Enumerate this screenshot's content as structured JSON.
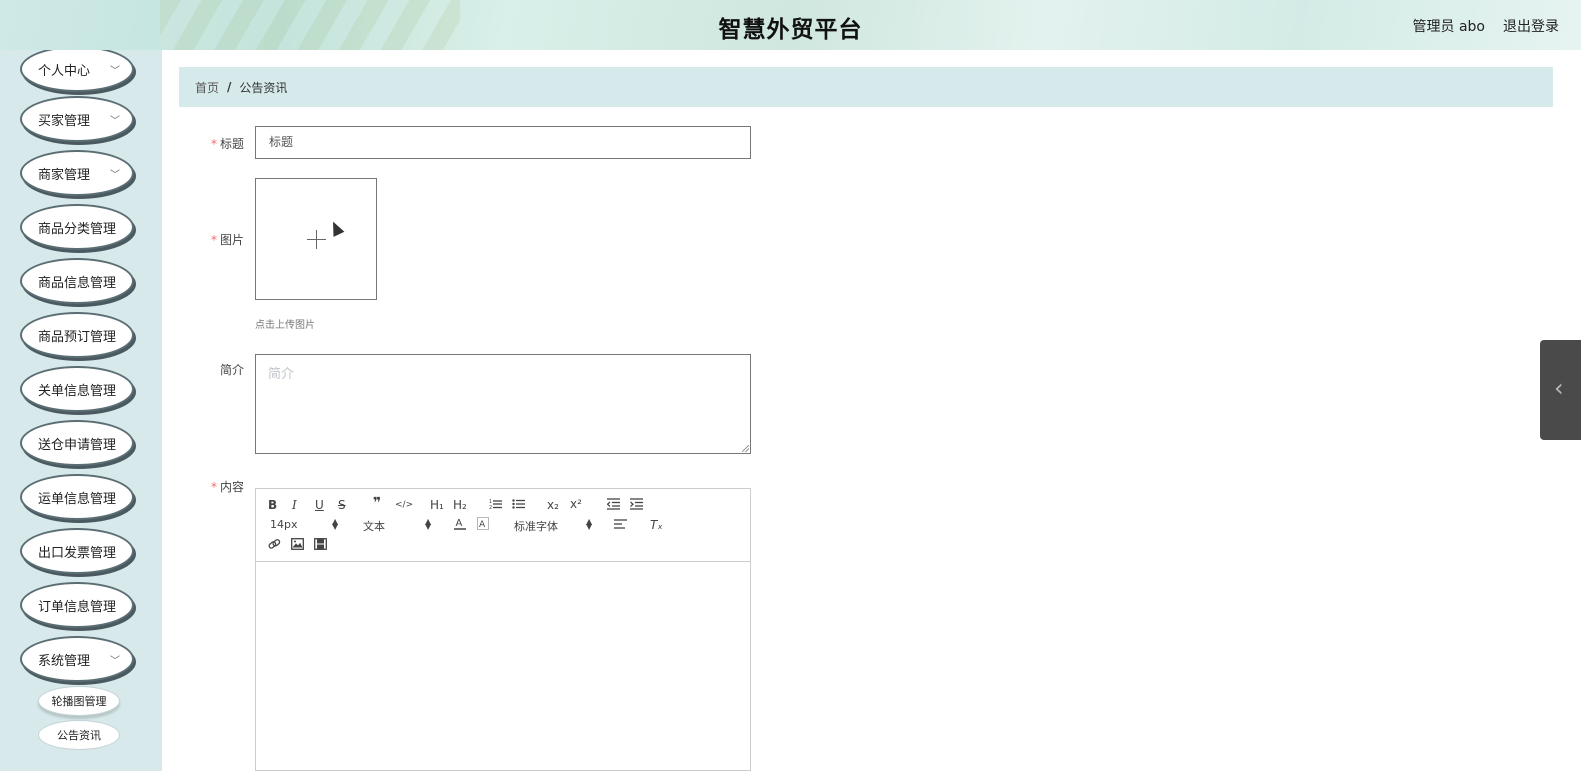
{
  "header": {
    "title": "智慧外贸平台",
    "user": "管理员 abo",
    "logout": "退出登录"
  },
  "sidebar": {
    "items": [
      {
        "label": "个人中心",
        "chevron": true
      },
      {
        "label": "买家管理",
        "chevron": true
      },
      {
        "label": "商家管理",
        "chevron": true
      },
      {
        "label": "商品分类管理",
        "chevron": false
      },
      {
        "label": "商品信息管理",
        "chevron": false
      },
      {
        "label": "商品预订管理",
        "chevron": false
      },
      {
        "label": "关单信息管理",
        "chevron": false
      },
      {
        "label": "送仓申请管理",
        "chevron": false
      },
      {
        "label": "运单信息管理",
        "chevron": false
      },
      {
        "label": "出口发票管理",
        "chevron": false
      },
      {
        "label": "订单信息管理",
        "chevron": false
      },
      {
        "label": "系统管理",
        "chevron": true
      }
    ],
    "sub_items": [
      "轮播图管理",
      "公告资讯"
    ]
  },
  "breadcrumb": {
    "home": "首页",
    "separator": "/",
    "current": "公告资讯"
  },
  "form": {
    "title_label": "标题",
    "title_placeholder": "标题",
    "image_label": "图片",
    "upload_hint": "点击上传图片",
    "intro_label": "简介",
    "intro_placeholder": "简介",
    "content_label": "内容",
    "required_mark": "*"
  },
  "editor": {
    "font_size": "14px",
    "header_select": "文本",
    "font_family": "标准字体",
    "btn_bold": "B",
    "btn_italic": "I",
    "btn_underline": "U",
    "btn_strike": "S",
    "btn_quote": "❞",
    "btn_code": "</>",
    "btn_h1": "H₁",
    "btn_h2": "H₂",
    "btn_sub": "x₂",
    "btn_sup": "x²",
    "btn_clean": "Tₓ"
  },
  "icons": {
    "chevron": "chevron-down-icon",
    "side_toggle": "chevron-left-icon"
  }
}
